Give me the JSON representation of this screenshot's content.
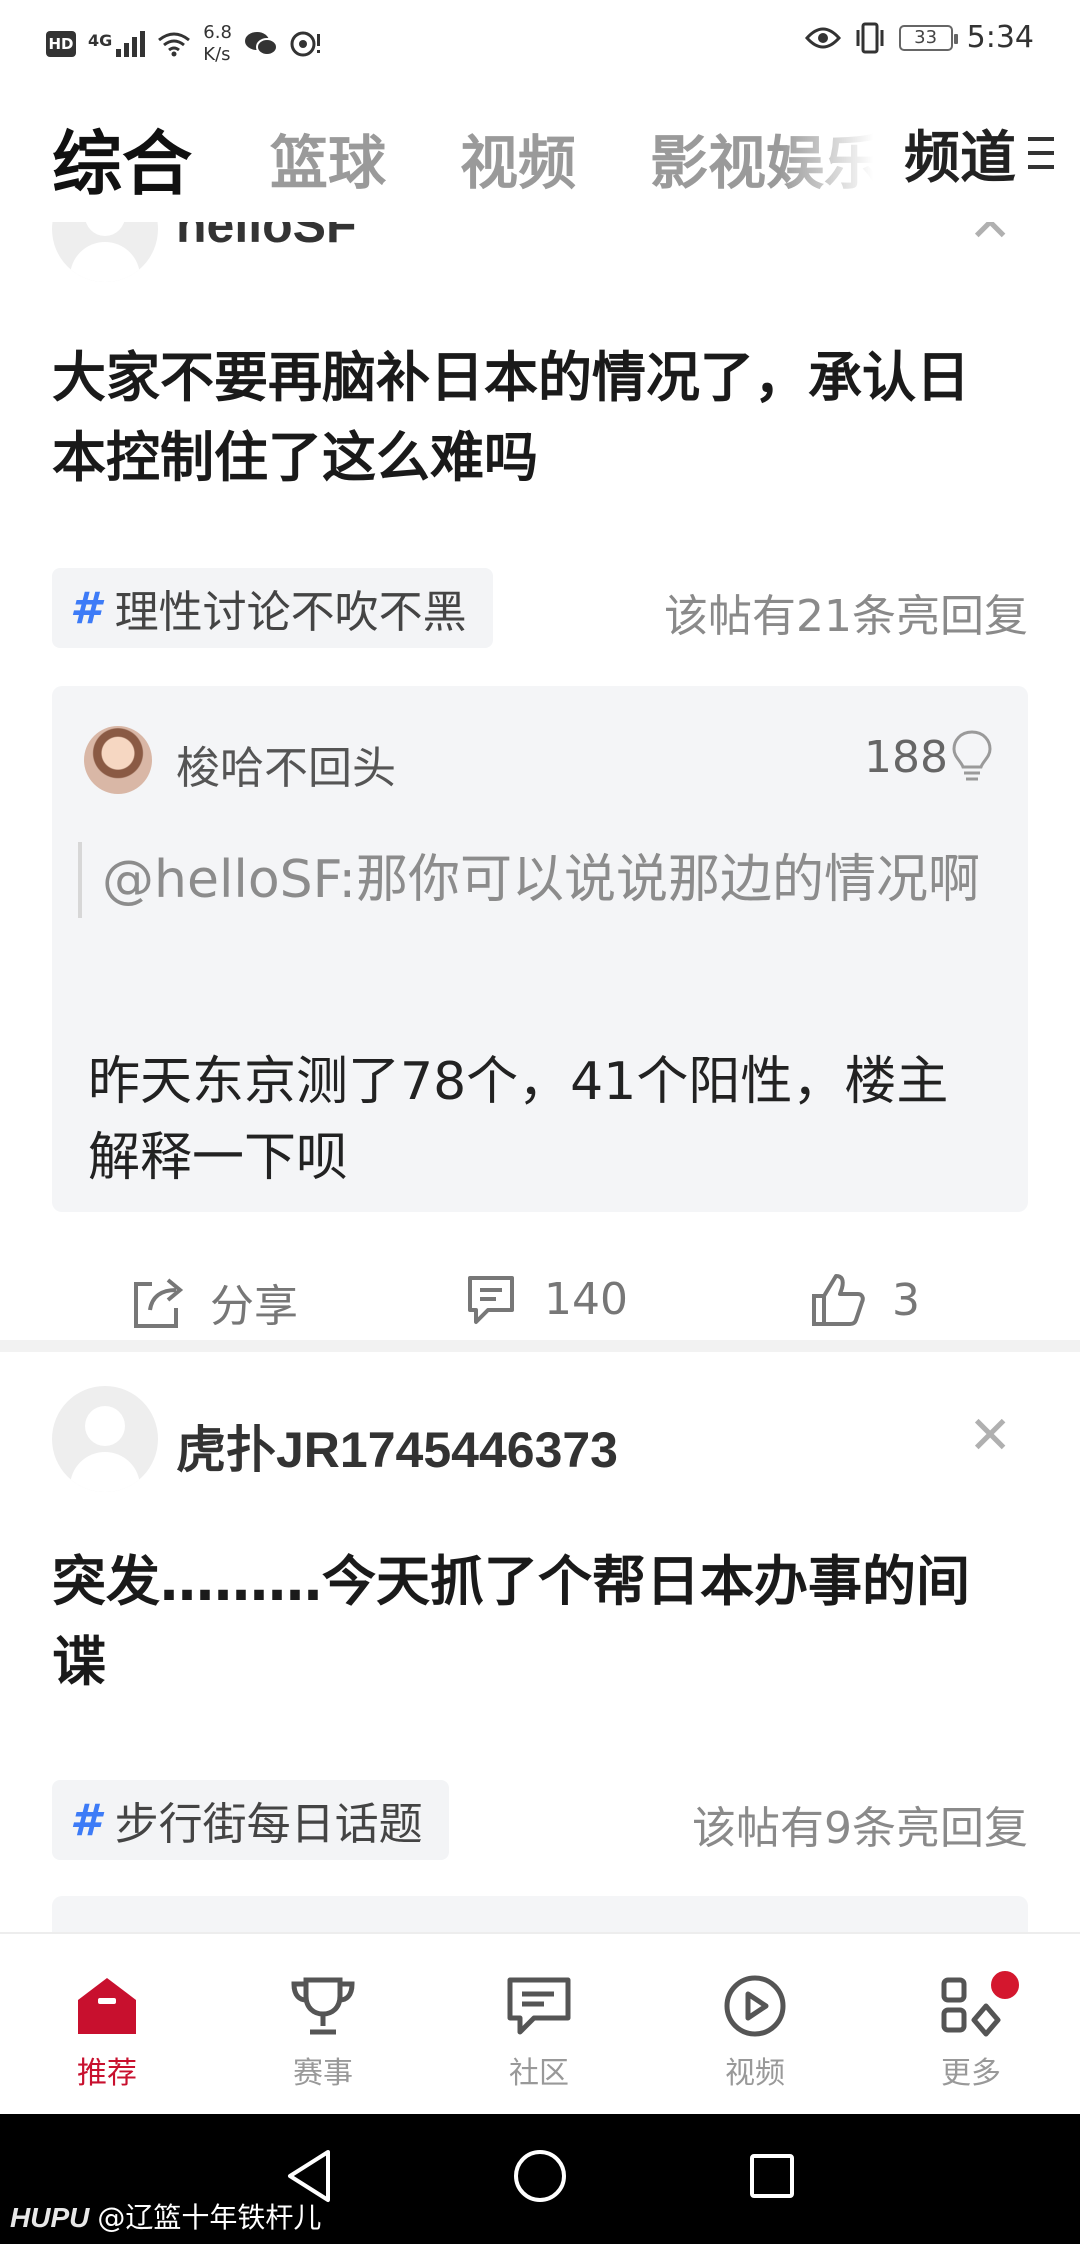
{
  "status_bar": {
    "hd": "HD",
    "signal": "4G",
    "speed_value": "6.8",
    "speed_unit": "K/s",
    "battery": "33",
    "time": "5:34"
  },
  "top_tabs": {
    "items": [
      "综合",
      "篮球",
      "视频",
      "影视娱乐"
    ],
    "active_index": 0,
    "channel_label": "频道"
  },
  "feed": {
    "posts": [
      {
        "username": "helloSF",
        "title": "大家不要再脑补日本的情况了，承认日本控制住了这么难吗",
        "topic": "理性讨论不吹不黑",
        "bright_replies": "该帖有21条亮回复",
        "reply": {
          "username": "梭哈不回头",
          "light_count": "188",
          "quote": "@helloSF:那你可以说说那边的情况啊",
          "body": "昨天东京测了78个，41个阳性，楼主解释一下呗"
        },
        "actions": {
          "share": "分享",
          "comments": "140",
          "likes": "3"
        }
      },
      {
        "username": "虎扑JR1745446373",
        "title": "突发………今天抓了个帮日本办事的间谍",
        "topic": "步行街每日话题",
        "bright_replies": "该帖有9条亮回复"
      }
    ]
  },
  "bottom_nav": {
    "items": [
      {
        "label": "推荐",
        "icon": "home-icon",
        "active": true
      },
      {
        "label": "赛事",
        "icon": "trophy-icon",
        "active": false
      },
      {
        "label": "社区",
        "icon": "chat-icon",
        "active": false
      },
      {
        "label": "视频",
        "icon": "play-icon",
        "active": false
      },
      {
        "label": "更多",
        "icon": "grid-icon",
        "active": false,
        "badge": true
      }
    ],
    "active_color": "#c8102e"
  },
  "watermark": {
    "brand": "HUPU",
    "handle": "@辽篮十年铁杆儿"
  }
}
